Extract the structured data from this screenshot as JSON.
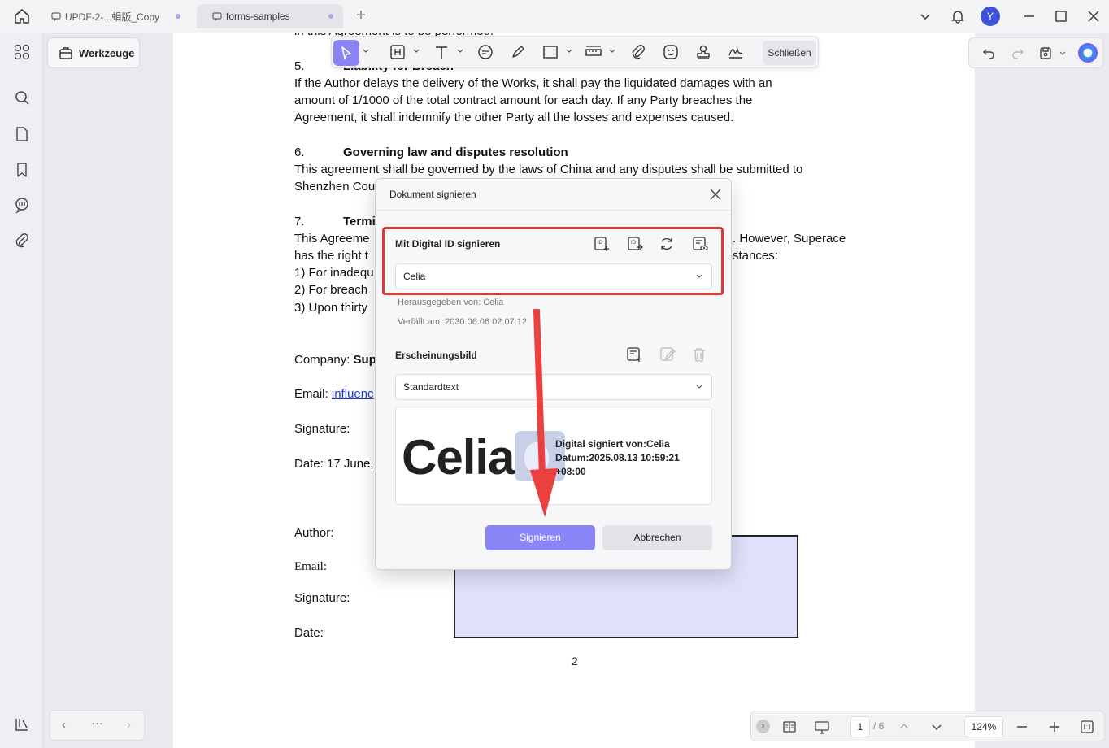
{
  "titlebar": {
    "tabs": [
      {
        "label": "UPDF-2-...蜎版_Copy"
      },
      {
        "label": "forms-samples"
      }
    ],
    "avatar_letter": "Y"
  },
  "sidebar": {
    "tools_label": "Werkzeuge",
    "nav_more": "···"
  },
  "toolbar": {
    "close_label": "Schließen"
  },
  "document": {
    "lines": [
      {
        "text": "in this Agreement is to be performed."
      },
      {
        "num": "5.",
        "heading": "Liability for Breach"
      },
      {
        "text": "If the Author delays the delivery of the Works, it shall pay the liquidated damages with an"
      },
      {
        "text": "amount of 1/1000 of the total contract amount for each day. If any Party breaches the"
      },
      {
        "text": "Agreement, it shall indemnify the other Party all the losses and expenses caused."
      },
      {
        "num": "6.",
        "heading": "Governing law and disputes resolution"
      },
      {
        "text": "This agreement shall be governed by the laws of China and any disputes shall be submitted to"
      },
      {
        "text": "Shenzhen Cou"
      },
      {
        "num": "7.",
        "heading": "Termi"
      },
      {
        "text": "This Agreeme",
        "tail": ". However, Superace"
      },
      {
        "text": "has the right t",
        "tail": "stances:"
      },
      {
        "text": "1) For inadequ"
      },
      {
        "text": "2) For breach"
      },
      {
        "text": "3)  Upon thirty"
      }
    ],
    "company_label": "Company:",
    "company_value": "Sup",
    "email_label": "Email:",
    "email_value": "influenc",
    "signature_label": "Signature:",
    "date_label": "Date: 17 June,",
    "author_label": "Author:",
    "email2_label": "Email:",
    "signature2_label": "Signature:",
    "date2_label": "Date:",
    "page_number": "2"
  },
  "dialog": {
    "title": "Dokument signieren",
    "digital_id_title": "Mit Digital ID signieren",
    "selected_id": "Celia",
    "issued_by": "Herausgegeben von: Celia",
    "expires": "Verfällt am: 2030.06.06 02:07:12",
    "appearance_title": "Erscheinungsbild",
    "appearance_value": "Standardtext",
    "preview_name": "Celia",
    "preview_line1": "Digital signiert von:Celia",
    "preview_line2": "Datum:2025.08.13 10:59:21",
    "preview_line3": "+08:00",
    "sign_label": "Signieren",
    "cancel_label": "Abbrechen"
  },
  "bottombar": {
    "current_page": "1",
    "total_pages": "/ 6",
    "zoom": "124%"
  },
  "colors": {
    "accent": "#8b86f6",
    "highlight": "#e2363a",
    "avatar": "#3f51d9"
  }
}
